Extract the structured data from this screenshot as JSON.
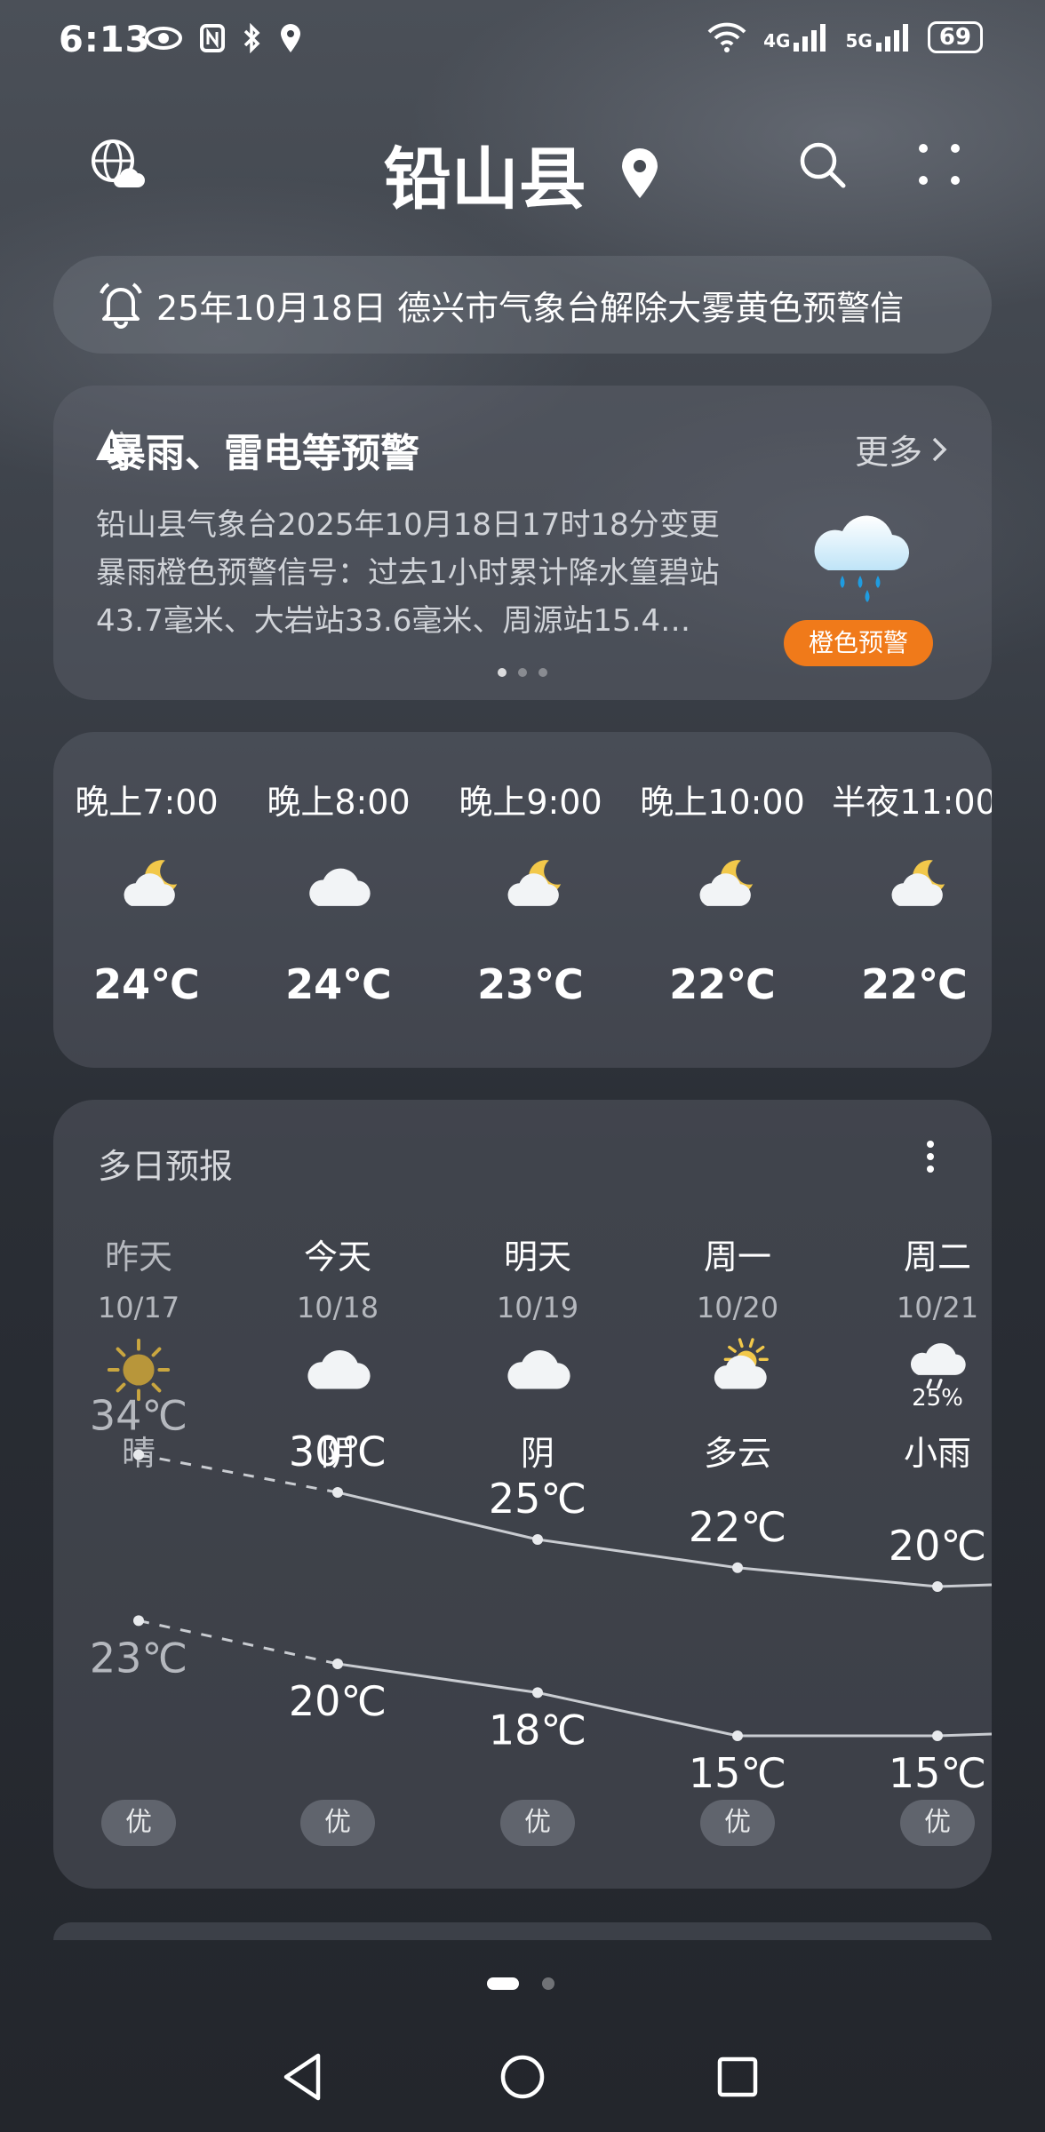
{
  "status_bar": {
    "time": "6:13",
    "signal_4g": "4G",
    "signal_5g": "5G",
    "battery": "69"
  },
  "header": {
    "city": "铅山县"
  },
  "ticker": {
    "text": "25年10月18日 德兴市气象台解除大雾黄色预警信"
  },
  "alert": {
    "title": "暴雨、雷电等预警",
    "more": "更多",
    "body": "铅山县气象台2025年10月18日17时18分变更暴雨橙色预警信号：过去1小时累计降水篁碧站43.7毫米、大岩站33.6毫米、周源站15.4…",
    "badge": "橙色预警",
    "badge_color": "#f07a1a"
  },
  "hourly": [
    {
      "time": "晚上7:00",
      "icon": "moon-cloud-icon",
      "temp": "24℃"
    },
    {
      "time": "晚上8:00",
      "icon": "cloud-icon",
      "temp": "24℃"
    },
    {
      "time": "晚上9:00",
      "icon": "moon-cloud-icon",
      "temp": "23℃"
    },
    {
      "time": "晚上10:00",
      "icon": "moon-cloud-icon",
      "temp": "22℃"
    },
    {
      "time": "半夜11:00",
      "icon": "moon-cloud-icon",
      "temp": "22℃"
    }
  ],
  "forecast": {
    "title": "多日预报",
    "days": [
      {
        "name": "昨天",
        "date": "10/17",
        "icon": "sun-icon",
        "precip": "",
        "cond": "晴",
        "high": "34℃",
        "low": "23℃",
        "aqi": "优",
        "high_val": 34,
        "low_val": 23
      },
      {
        "name": "今天",
        "date": "10/18",
        "icon": "cloud-icon",
        "precip": "",
        "cond": "阴",
        "high": "30℃",
        "low": "20℃",
        "aqi": "优",
        "high_val": 30,
        "low_val": 20
      },
      {
        "name": "明天",
        "date": "10/19",
        "icon": "cloud-icon",
        "precip": "",
        "cond": "阴",
        "high": "25℃",
        "low": "18℃",
        "aqi": "优",
        "high_val": 25,
        "low_val": 18
      },
      {
        "name": "周一",
        "date": "10/20",
        "icon": "sun-cloud-icon",
        "precip": "",
        "cond": "多云",
        "high": "22℃",
        "low": "15℃",
        "aqi": "优",
        "high_val": 22,
        "low_val": 15
      },
      {
        "name": "周二",
        "date": "10/21",
        "icon": "rain-cloud-icon",
        "precip": "25%",
        "cond": "小雨",
        "high": "20℃",
        "low": "15℃",
        "aqi": "优",
        "high_val": 20,
        "low_val": 15
      }
    ]
  }
}
